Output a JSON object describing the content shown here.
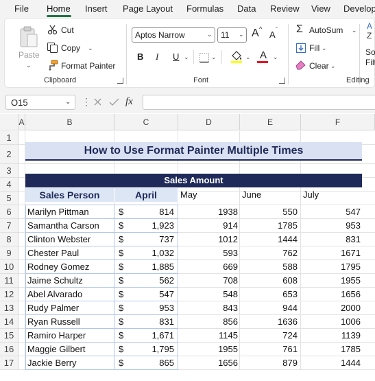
{
  "menu": {
    "items": [
      "File",
      "Home",
      "Insert",
      "Page Layout",
      "Formulas",
      "Data",
      "Review",
      "View",
      "Develop"
    ],
    "active": "Home"
  },
  "ribbon": {
    "clipboard": {
      "paste_label": "Paste",
      "cut_label": "Cut",
      "copy_label": "Copy",
      "format_painter_label": "Format Painter",
      "group_label": "Clipboard"
    },
    "font": {
      "font_name": "Aptos Narrow",
      "font_size": "11",
      "bold": "B",
      "italic": "I",
      "underline": "U",
      "font_color_glyph": "A",
      "grow_glyph": "A",
      "shrink_glyph": "A",
      "group_label": "Font"
    },
    "editing": {
      "autosum_label": "AutoSum",
      "fill_label": "Fill",
      "clear_label": "Clear",
      "sort_label": "Sor",
      "filter_label": "Filt",
      "group_label": "Editing"
    },
    "colors": {
      "accent": "#1e7145",
      "font_color": "#e81123",
      "highlight": "#ffff00"
    }
  },
  "formula_bar": {
    "name_box": "O15",
    "fx_label": "fx",
    "formula": ""
  },
  "sheet": {
    "columns": [
      "A",
      "B",
      "C",
      "D",
      "E",
      "F"
    ],
    "rows": [
      "1",
      "2",
      "3",
      "4",
      "5",
      "6",
      "7",
      "8",
      "9",
      "10",
      "11",
      "12",
      "13",
      "14",
      "15",
      "16",
      "17"
    ],
    "title": "How to Use Format Painter Multiple Times",
    "band_header": "Sales Amount",
    "col_headers": {
      "sales_person": "Sales Person",
      "april": "April",
      "may": "May",
      "june": "June",
      "july": "July"
    },
    "currency_symbol": "$",
    "records": [
      {
        "name": "Marilyn Pittman",
        "april": "814",
        "may": "1938",
        "june": "550",
        "july": "547"
      },
      {
        "name": "Samantha Carson",
        "april": "1,923",
        "may": "914",
        "june": "1785",
        "july": "953"
      },
      {
        "name": "Clinton Webster",
        "april": "737",
        "may": "1012",
        "june": "1444",
        "july": "831"
      },
      {
        "name": "Chester Paul",
        "april": "1,032",
        "may": "593",
        "june": "762",
        "july": "1671"
      },
      {
        "name": "Rodney Gomez",
        "april": "1,885",
        "may": "669",
        "june": "588",
        "july": "1795"
      },
      {
        "name": "Jaime Schultz",
        "april": "562",
        "may": "708",
        "june": "608",
        "july": "1955"
      },
      {
        "name": "Abel Alvarado",
        "april": "547",
        "may": "548",
        "june": "653",
        "july": "1656"
      },
      {
        "name": "Rudy Palmer",
        "april": "953",
        "may": "843",
        "june": "944",
        "july": "2000"
      },
      {
        "name": "Ryan Russell",
        "april": "831",
        "may": "856",
        "june": "1636",
        "july": "1006"
      },
      {
        "name": "Ramiro Harper",
        "april": "1,671",
        "may": "1145",
        "june": "724",
        "july": "1139"
      },
      {
        "name": "Maggie Gilbert",
        "april": "1,795",
        "may": "1955",
        "june": "761",
        "july": "1785"
      },
      {
        "name": "Jackie Berry",
        "april": "865",
        "may": "1656",
        "june": "879",
        "july": "1444"
      }
    ]
  }
}
